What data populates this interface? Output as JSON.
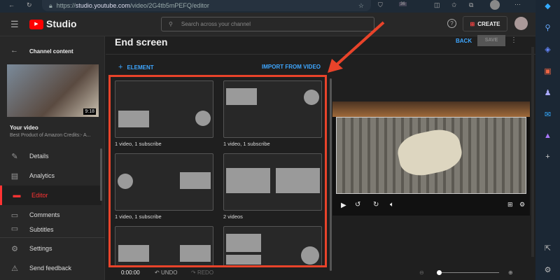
{
  "browser": {
    "url_host": "studio.youtube.com",
    "url_prefix": "https://",
    "url_path": "/video/2G4tb5mPEFQ/editor",
    "badge": "36"
  },
  "header": {
    "logo": "Studio",
    "search_placeholder": "Search across your channel",
    "create_label": "CREATE"
  },
  "sidebar": {
    "back_label": "Channel content",
    "duration": "9:18",
    "your_video": "Your video",
    "video_title": "Best Product of Amazon Credits:- A...",
    "items": [
      {
        "label": "Details",
        "icon": "pencil-icon"
      },
      {
        "label": "Analytics",
        "icon": "analytics-icon"
      },
      {
        "label": "Editor",
        "icon": "editor-icon"
      },
      {
        "label": "Comments",
        "icon": "comments-icon"
      },
      {
        "label": "Subtitles",
        "icon": "subtitles-icon"
      }
    ],
    "bottom": [
      {
        "label": "Settings",
        "icon": "gear-icon"
      },
      {
        "label": "Send feedback",
        "icon": "feedback-icon"
      }
    ]
  },
  "editor": {
    "title": "End screen",
    "back": "BACK",
    "save": "SAVE",
    "add_element": "ELEMENT",
    "import": "IMPORT FROM VIDEO",
    "templates": [
      "1 video, 1 subscribe",
      "1 video, 1 subscribe",
      "1 video, 1 subscribe",
      "2 videos"
    ],
    "timecode": "0:00:00",
    "undo": "UNDO",
    "redo": "REDO"
  },
  "colors": {
    "accent": "#3ea6ff",
    "highlight": "#e8432a",
    "youtube_red": "#ff0000"
  }
}
